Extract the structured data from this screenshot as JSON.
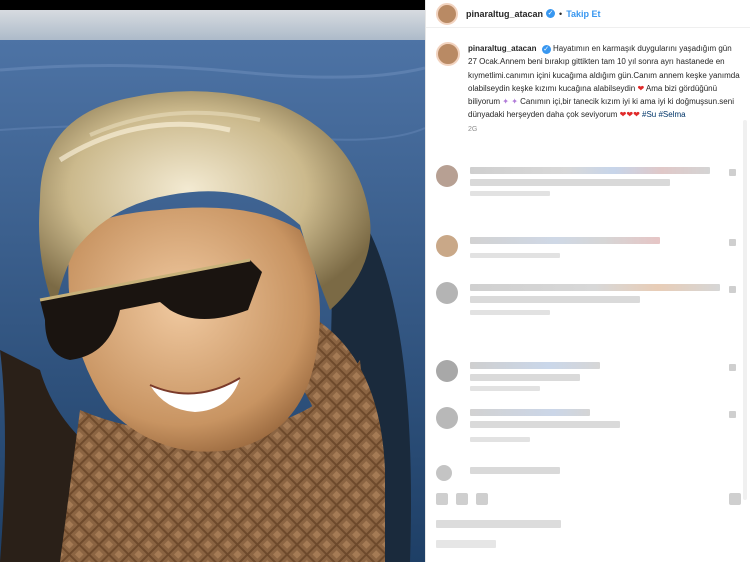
{
  "header": {
    "username": "pinaraltug_atacan",
    "separator": "•",
    "follow_label": "Takip Et"
  },
  "post": {
    "caption_username": "pinaraltug_atacan",
    "caption_part1": "Hayatımın en karmaşık duygularını yaşadığım gün 27 Ocak.Annem beni bırakıp gittikten tam 10 yıl sonra ayrı hastanede en kıymetlimi.canımın içini kucağıma aldığım gün.Canım annem keşke yanımda olabilseydin keşke kızımı kucağına alabilseydin",
    "caption_part2": "Ama bizi gördüğünü biliyorum",
    "caption_part3": "Canımın içi,bir tanecik kızım iyi ki ama iyi ki doğmuşsun.seni dünyadaki herşeyden daha çok seviyorum",
    "hashtag1": "#Su",
    "hashtag2": "#Selma",
    "time": "2G"
  },
  "colors": {
    "link_blue": "#3897f0",
    "heart_red": "#e02b2b",
    "text": "#262626"
  },
  "icons": [
    "verified-badge-icon",
    "heart-icon",
    "sparkles-icon",
    "like-icon",
    "comment-icon",
    "share-icon",
    "save-icon"
  ]
}
